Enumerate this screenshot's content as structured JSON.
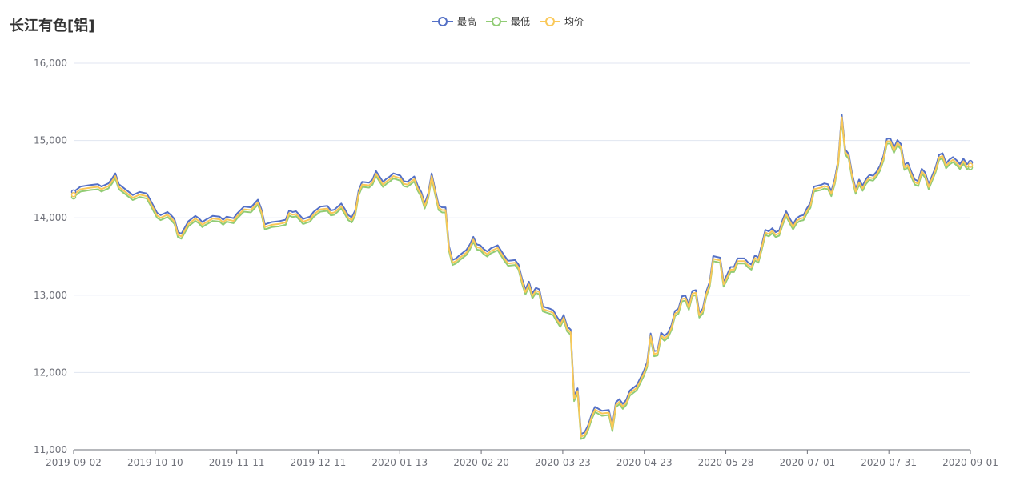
{
  "chart_data": {
    "type": "line",
    "title": "长江有色[铝]",
    "ylim": [
      11000,
      16000
    ],
    "yticks": [
      11000,
      12000,
      13000,
      14000,
      15000,
      16000
    ],
    "ytick_labels": [
      "11,000",
      "12,000",
      "13,000",
      "14,000",
      "15,000",
      "16,000"
    ],
    "xtick_labels": [
      "2019-09-02",
      "2019-10-10",
      "2019-11-11",
      "2019-12-11",
      "2020-01-13",
      "2020-02-20",
      "2020-03-23",
      "2020-04-23",
      "2020-05-28",
      "2020-07-01",
      "2020-07-31",
      "2020-09-01"
    ],
    "grid": true,
    "legend_position": "top-center",
    "avg_points": [
      [
        0,
        14300
      ],
      [
        2,
        14370
      ],
      [
        5,
        14390
      ],
      [
        7,
        14400
      ],
      [
        8,
        14370
      ],
      [
        10,
        14410
      ],
      [
        11,
        14470
      ],
      [
        12,
        14540
      ],
      [
        13,
        14400
      ],
      [
        15,
        14330
      ],
      [
        17,
        14260
      ],
      [
        19,
        14300
      ],
      [
        21,
        14280
      ],
      [
        22,
        14200
      ],
      [
        24,
        14030
      ],
      [
        25,
        14000
      ],
      [
        27,
        14040
      ],
      [
        28,
        14000
      ],
      [
        29,
        13950
      ],
      [
        30,
        13780
      ],
      [
        31,
        13760
      ],
      [
        33,
        13920
      ],
      [
        35,
        13990
      ],
      [
        36,
        13960
      ],
      [
        37,
        13910
      ],
      [
        38,
        13940
      ],
      [
        40,
        13990
      ],
      [
        42,
        13980
      ],
      [
        43,
        13940
      ],
      [
        44,
        13980
      ],
      [
        46,
        13960
      ],
      [
        47,
        14020
      ],
      [
        49,
        14110
      ],
      [
        51,
        14100
      ],
      [
        53,
        14200
      ],
      [
        54,
        14080
      ],
      [
        55,
        13880
      ],
      [
        57,
        13910
      ],
      [
        59,
        13920
      ],
      [
        61,
        13940
      ],
      [
        62,
        14060
      ],
      [
        63,
        14040
      ],
      [
        64,
        14050
      ],
      [
        66,
        13950
      ],
      [
        68,
        13980
      ],
      [
        69,
        14040
      ],
      [
        71,
        14110
      ],
      [
        73,
        14120
      ],
      [
        74,
        14060
      ],
      [
        75,
        14070
      ],
      [
        77,
        14150
      ],
      [
        78,
        14080
      ],
      [
        79,
        14000
      ],
      [
        80,
        13970
      ],
      [
        81,
        14060
      ],
      [
        82,
        14320
      ],
      [
        83,
        14430
      ],
      [
        85,
        14420
      ],
      [
        86,
        14460
      ],
      [
        87,
        14570
      ],
      [
        89,
        14430
      ],
      [
        90,
        14470
      ],
      [
        91,
        14500
      ],
      [
        92,
        14540
      ],
      [
        94,
        14510
      ],
      [
        95,
        14440
      ],
      [
        96,
        14430
      ],
      [
        98,
        14500
      ],
      [
        99,
        14380
      ],
      [
        100,
        14300
      ],
      [
        101,
        14150
      ],
      [
        102,
        14280
      ],
      [
        103,
        14540
      ],
      [
        104,
        14330
      ],
      [
        105,
        14130
      ],
      [
        106,
        14100
      ],
      [
        107,
        14100
      ],
      [
        108,
        13600
      ],
      [
        109,
        13420
      ],
      [
        110,
        13440
      ],
      [
        111,
        13480
      ],
      [
        113,
        13550
      ],
      [
        114,
        13620
      ],
      [
        115,
        13720
      ],
      [
        116,
        13620
      ],
      [
        117,
        13610
      ],
      [
        118,
        13560
      ],
      [
        119,
        13530
      ],
      [
        120,
        13570
      ],
      [
        122,
        13610
      ],
      [
        123,
        13540
      ],
      [
        124,
        13470
      ],
      [
        125,
        13410
      ],
      [
        127,
        13420
      ],
      [
        128,
        13360
      ],
      [
        129,
        13180
      ],
      [
        130,
        13040
      ],
      [
        131,
        13140
      ],
      [
        132,
        12990
      ],
      [
        133,
        13060
      ],
      [
        134,
        13040
      ],
      [
        135,
        12820
      ],
      [
        137,
        12790
      ],
      [
        138,
        12770
      ],
      [
        139,
        12690
      ],
      [
        140,
        12620
      ],
      [
        141,
        12710
      ],
      [
        142,
        12560
      ],
      [
        143,
        12520
      ],
      [
        144,
        11660
      ],
      [
        145,
        11760
      ],
      [
        146,
        11170
      ],
      [
        147,
        11190
      ],
      [
        148,
        11280
      ],
      [
        149,
        11420
      ],
      [
        150,
        11520
      ],
      [
        152,
        11470
      ],
      [
        154,
        11480
      ],
      [
        155,
        11270
      ],
      [
        156,
        11580
      ],
      [
        157,
        11620
      ],
      [
        158,
        11560
      ],
      [
        159,
        11610
      ],
      [
        160,
        11730
      ],
      [
        162,
        11800
      ],
      [
        164,
        11980
      ],
      [
        165,
        12100
      ],
      [
        166,
        12470
      ],
      [
        167,
        12240
      ],
      [
        168,
        12250
      ],
      [
        169,
        12480
      ],
      [
        170,
        12440
      ],
      [
        171,
        12480
      ],
      [
        172,
        12580
      ],
      [
        173,
        12760
      ],
      [
        174,
        12790
      ],
      [
        175,
        12950
      ],
      [
        176,
        12960
      ],
      [
        177,
        12840
      ],
      [
        178,
        13020
      ],
      [
        179,
        13030
      ],
      [
        180,
        12740
      ],
      [
        181,
        12790
      ],
      [
        182,
        13010
      ],
      [
        183,
        13140
      ],
      [
        184,
        13470
      ],
      [
        185,
        13460
      ],
      [
        186,
        13450
      ],
      [
        187,
        13140
      ],
      [
        188,
        13230
      ],
      [
        189,
        13330
      ],
      [
        190,
        13330
      ],
      [
        191,
        13440
      ],
      [
        193,
        13440
      ],
      [
        194,
        13390
      ],
      [
        195,
        13360
      ],
      [
        196,
        13480
      ],
      [
        197,
        13450
      ],
      [
        198,
        13620
      ],
      [
        199,
        13810
      ],
      [
        200,
        13790
      ],
      [
        201,
        13830
      ],
      [
        202,
        13780
      ],
      [
        203,
        13800
      ],
      [
        204,
        13940
      ],
      [
        205,
        14050
      ],
      [
        206,
        13960
      ],
      [
        207,
        13880
      ],
      [
        208,
        13960
      ],
      [
        209,
        13990
      ],
      [
        210,
        14000
      ],
      [
        211,
        14090
      ],
      [
        212,
        14160
      ],
      [
        213,
        14370
      ],
      [
        214,
        14380
      ],
      [
        215,
        14390
      ],
      [
        216,
        14410
      ],
      [
        217,
        14400
      ],
      [
        218,
        14310
      ],
      [
        219,
        14470
      ],
      [
        220,
        14720
      ],
      [
        221,
        15300
      ],
      [
        222,
        14850
      ],
      [
        223,
        14790
      ],
      [
        224,
        14530
      ],
      [
        225,
        14340
      ],
      [
        226,
        14460
      ],
      [
        227,
        14380
      ],
      [
        228,
        14470
      ],
      [
        229,
        14520
      ],
      [
        230,
        14510
      ],
      [
        231,
        14560
      ],
      [
        232,
        14640
      ],
      [
        233,
        14770
      ],
      [
        234,
        14990
      ],
      [
        235,
        14990
      ],
      [
        236,
        14870
      ],
      [
        237,
        14970
      ],
      [
        238,
        14920
      ],
      [
        239,
        14650
      ],
      [
        240,
        14680
      ],
      [
        241,
        14560
      ],
      [
        242,
        14460
      ],
      [
        243,
        14440
      ],
      [
        244,
        14600
      ],
      [
        245,
        14550
      ],
      [
        246,
        14400
      ],
      [
        247,
        14510
      ],
      [
        248,
        14620
      ],
      [
        249,
        14780
      ],
      [
        250,
        14800
      ],
      [
        251,
        14670
      ],
      [
        252,
        14720
      ],
      [
        253,
        14750
      ],
      [
        254,
        14710
      ],
      [
        255,
        14660
      ],
      [
        256,
        14730
      ],
      [
        257,
        14660
      ],
      [
        258,
        14680
      ]
    ],
    "series": [
      {
        "name": "最高",
        "color": "#5470c6",
        "offset": 35
      },
      {
        "name": "最低",
        "color": "#91cc75",
        "offset": -30
      },
      {
        "name": "均价",
        "color": "#fac858",
        "offset": 0
      }
    ]
  }
}
